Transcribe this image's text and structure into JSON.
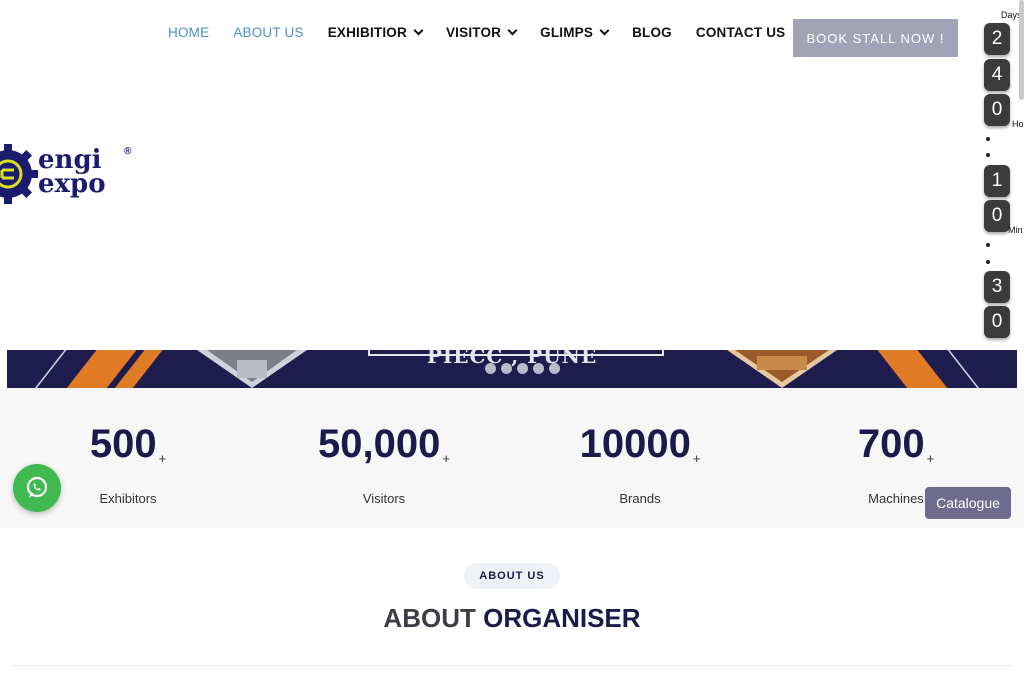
{
  "nav": {
    "items": [
      {
        "label": "HOME",
        "dropdown": false
      },
      {
        "label": "ABOUT US",
        "dropdown": false
      },
      {
        "label": "EXHIBITIOR",
        "dropdown": true
      },
      {
        "label": "VISITOR",
        "dropdown": true
      },
      {
        "label": "GLIMPS",
        "dropdown": true
      },
      {
        "label": "BLOG",
        "dropdown": false
      },
      {
        "label": "CONTACT US",
        "dropdown": false
      }
    ],
    "book_button": "BOOK STALL NOW !"
  },
  "countdown": {
    "days_label": "Days",
    "days": [
      "2",
      "4",
      "0"
    ],
    "hours_label": "Ho",
    "hours": [
      "1",
      "0"
    ],
    "minutes_label": "Min",
    "minutes": [
      "3",
      "0"
    ]
  },
  "logo": {
    "line1": "engi",
    "line2": "expo",
    "reg": "®"
  },
  "banner": {
    "text": "PIECC , PUNE",
    "slide_count": 5
  },
  "stats": [
    {
      "value": "500",
      "suffix": "+",
      "label": "Exhibitors"
    },
    {
      "value": "50,000",
      "suffix": "+",
      "label": "Visitors"
    },
    {
      "value": "10000",
      "suffix": "+",
      "label": "Brands"
    },
    {
      "value": "700",
      "suffix": "+",
      "label": "Machines"
    }
  ],
  "catalogue": "Catalogue",
  "about": {
    "pill": "ABOUT US",
    "title_part1": "ABOUT",
    "title_part2": "ORGANISER"
  },
  "colors": {
    "brand_navy": "#1b1a4a",
    "nav_active": "#4c8fc9",
    "book_button": "#a3a3b8",
    "whatsapp": "#3fb950",
    "catalogue": "#6e6b8e",
    "banner_orange": "#e07a24"
  },
  "icons": {
    "whatsapp": "whatsapp-icon",
    "chevron": "chevron-down-icon"
  }
}
